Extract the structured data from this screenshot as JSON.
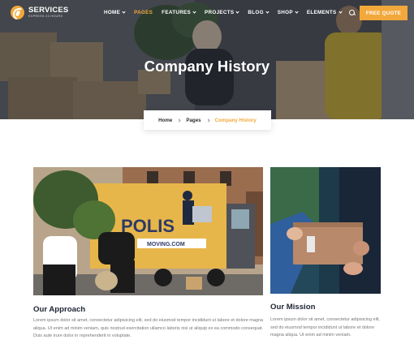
{
  "header": {
    "logo_title": "SERVICES",
    "logo_subtitle": "EXPRESS 24 HOURS",
    "menu": [
      {
        "label": "HOME",
        "dropdown": true,
        "active": false
      },
      {
        "label": "PAGES",
        "dropdown": false,
        "active": true
      },
      {
        "label": "FEATURES",
        "dropdown": true,
        "active": false
      },
      {
        "label": "PROJECTS",
        "dropdown": true,
        "active": false
      },
      {
        "label": "BLOG",
        "dropdown": true,
        "active": false
      },
      {
        "label": "SHOP",
        "dropdown": true,
        "active": false
      },
      {
        "label": "ELEMENTS",
        "dropdown": true,
        "active": false
      }
    ],
    "search_icon": "search-icon",
    "cta_label": "FREE QUOTE"
  },
  "hero": {
    "title": "Company History"
  },
  "breadcrumb": {
    "items": [
      "Home",
      "Pages",
      "Company History"
    ]
  },
  "cards": [
    {
      "title": "Our Approach",
      "text": "Lorem ipsum dolor sit amet, consectetur adipisicing elit, sed do eiusmod tempor incididunt ut labore et dolore magna aliqua. Ut enim ad minim veniam, quis nostrud exercitation ullamco laboris nisi ut aliquip ex ea commodo consequat. Duis aute irure dolor in reprehenderit in voluptate."
    },
    {
      "title": "Our Mission",
      "text": "Lorem ipsum dolor sit amet, consectetur adipisicing elit, sed do eiusmod tempor incididunt ut labore et dolore magna aliqua. Ut enim ad minim veniam."
    }
  ],
  "truck_sign": {
    "brand": "POLIS",
    "url": "MOVING.COM"
  },
  "colors": {
    "accent": "#f2a83b",
    "heading": "#1d2432",
    "body_text": "#777777",
    "truck_body": "#e7b64a"
  }
}
